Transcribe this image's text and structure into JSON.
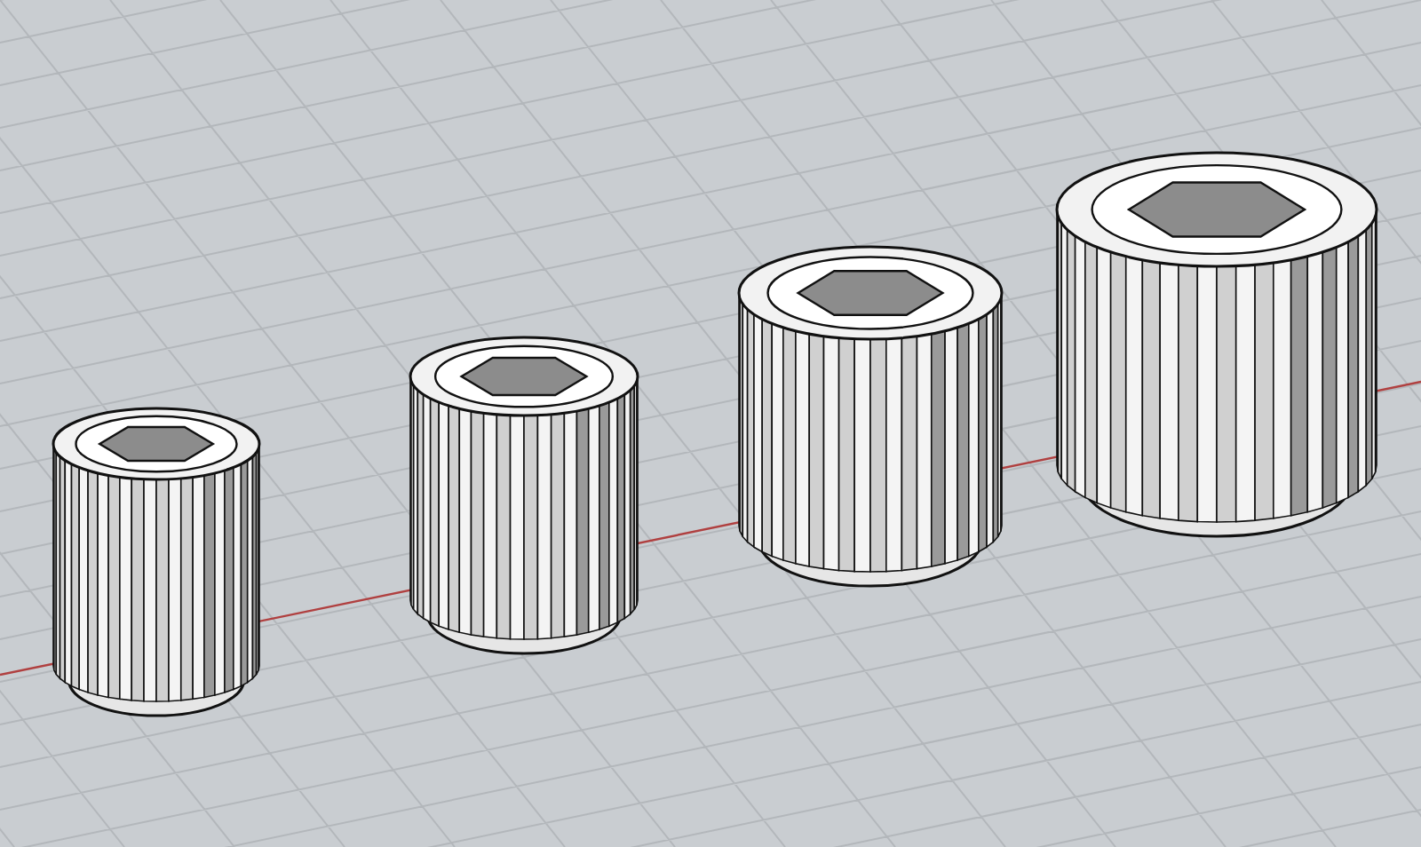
{
  "scene": {
    "items": [
      {
        "kind": "knurled-nut"
      },
      {
        "kind": "knurled-nut"
      },
      {
        "kind": "knurled-nut"
      },
      {
        "kind": "knurled-nut"
      }
    ]
  }
}
